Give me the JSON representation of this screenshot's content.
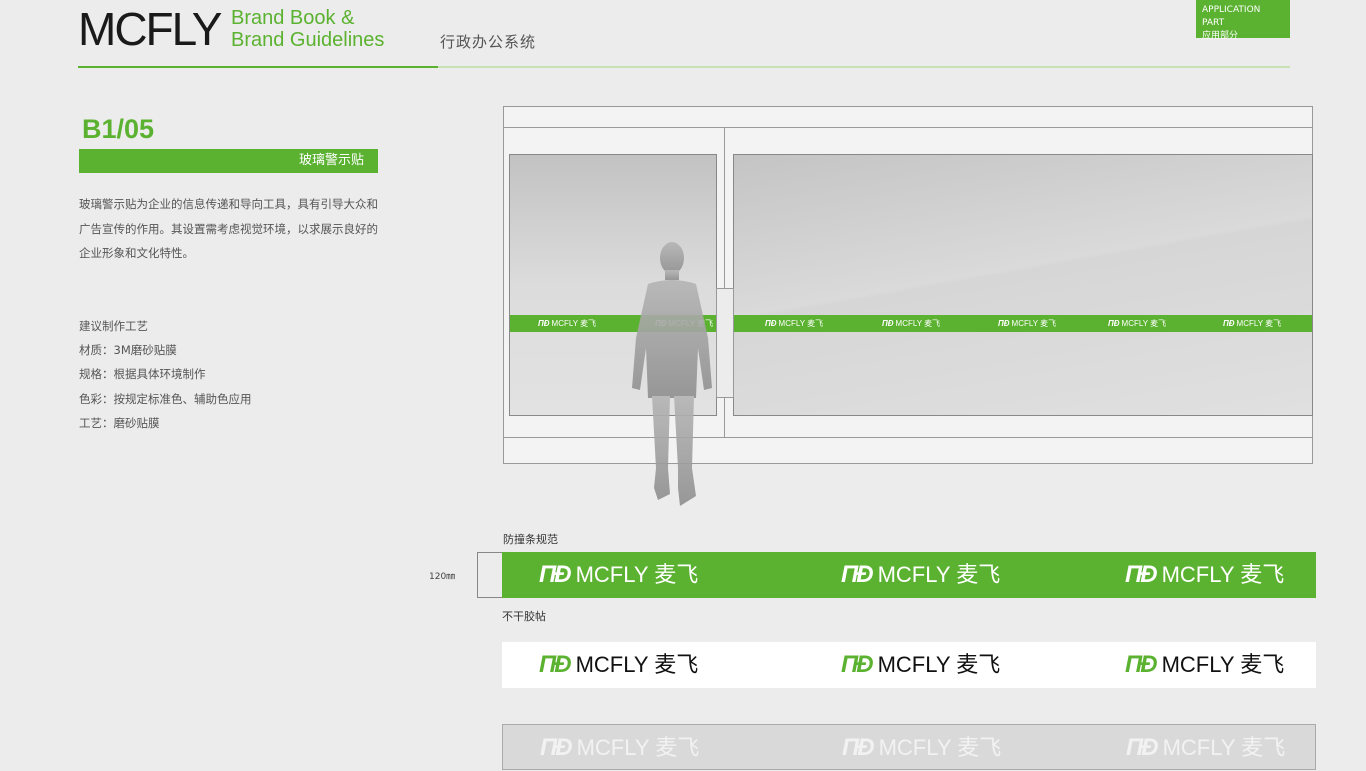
{
  "header": {
    "logo_text": "MCFLY",
    "brand_line1": "Brand Book &",
    "brand_line2": "Brand Guidelines",
    "section_cn": "行政办公系统",
    "badge_en": "APPLICATION PART",
    "badge_cn": "应用部分"
  },
  "page": {
    "code": "B1/05",
    "title": "玻璃警示贴",
    "description": "玻璃警示贴为企业的信息传递和导向工具，具有引导大众和广告宣传的作用。其设置需考虑视觉环境，以求展示良好的企业形象和文化特性。",
    "specs": [
      "建议制作工艺",
      "材质：3M磨砂贴膜",
      "规格：根据具体环境制作",
      "色彩：按规定标准色、辅助色应用",
      "工艺：磨砂贴膜"
    ]
  },
  "brand_mark": {
    "symbol": "ΠÐ",
    "name": "MCFLY 麦飞"
  },
  "bands": {
    "dimension_label": "120㎜",
    "label_green": "防撞条规范",
    "label_white": "不干胶帖"
  },
  "colors": {
    "primary_green": "#5bb230",
    "light_green": "#c7e3b4",
    "frosted_gray": "#d9d9d9"
  }
}
